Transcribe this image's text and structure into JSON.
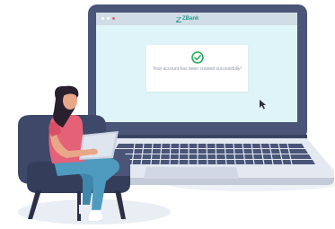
{
  "screen": {
    "brand_name": "ZBank",
    "message": "Your account has been created successfully!",
    "status_icon": "check-circle-icon"
  },
  "colors": {
    "laptop_body": "#4a5578",
    "laptop_base": "#e3e8f1",
    "screen_bg": "#dff4f8",
    "titlebar": "#d0dde7",
    "success_green": "#27ae60",
    "brand_teal": "#2a9a8c",
    "chair": "#3e4868",
    "shirt": "#e56177",
    "jeans": "#4e9bbf",
    "hair": "#2a1f2d",
    "skin": "#e9a789",
    "floor_shadow": "#e9edf4"
  }
}
